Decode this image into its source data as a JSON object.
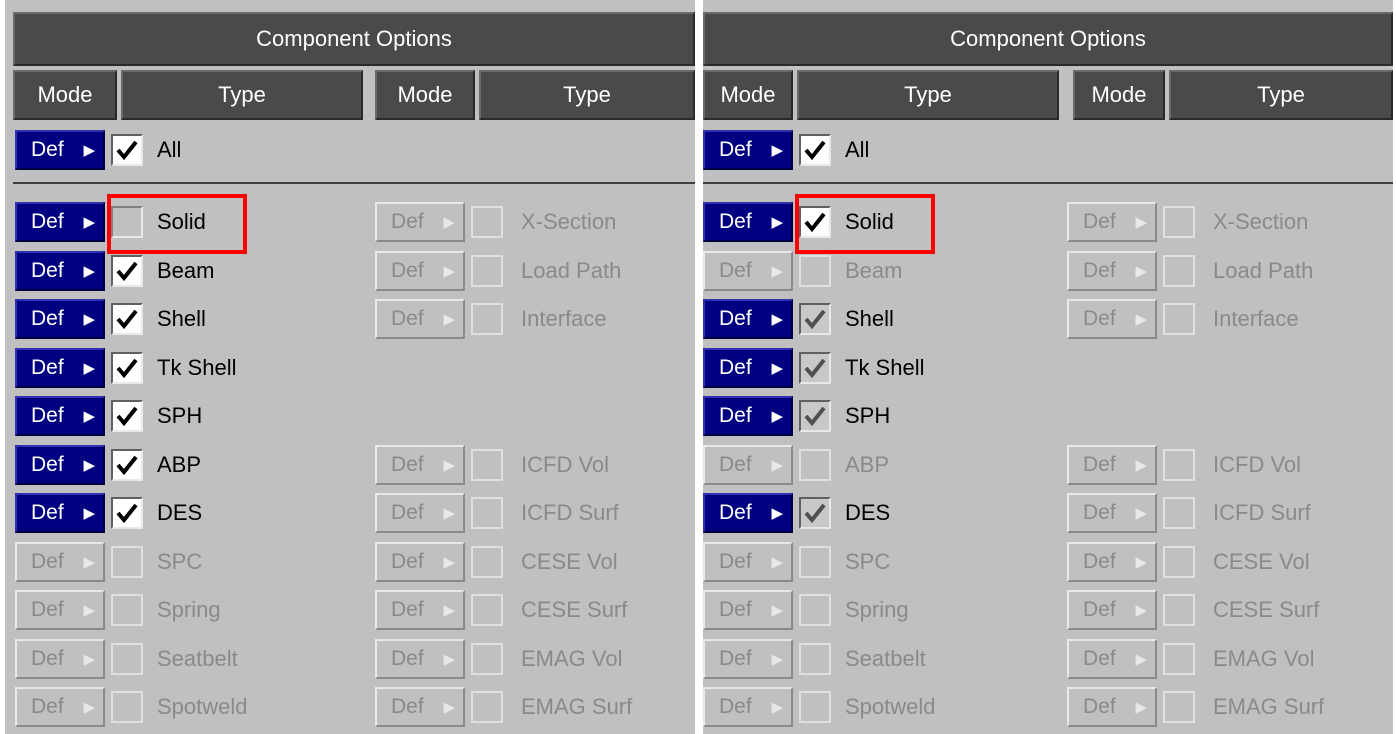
{
  "panels": [
    {
      "title": "Component Options",
      "col_mode": "Mode",
      "col_type": "Type",
      "all": {
        "mode": "Def",
        "label": "All",
        "checked": true,
        "active": true
      },
      "left_items": [
        {
          "mode": "Def",
          "label": "Solid",
          "active": true,
          "checked": false,
          "dim": false,
          "highlighted": true
        },
        {
          "mode": "Def",
          "label": "Beam",
          "active": true,
          "checked": true,
          "dim": false
        },
        {
          "mode": "Def",
          "label": "Shell",
          "active": true,
          "checked": true,
          "dim": false
        },
        {
          "mode": "Def",
          "label": "Tk Shell",
          "active": true,
          "checked": true,
          "dim": false
        },
        {
          "mode": "Def",
          "label": "SPH",
          "active": true,
          "checked": true,
          "dim": false
        },
        {
          "mode": "Def",
          "label": "ABP",
          "active": true,
          "checked": true,
          "dim": false
        },
        {
          "mode": "Def",
          "label": "DES",
          "active": true,
          "checked": true,
          "dim": false
        },
        {
          "mode": "Def",
          "label": "SPC",
          "active": false,
          "checked": false,
          "dim": false
        },
        {
          "mode": "Def",
          "label": "Spring",
          "active": false,
          "checked": false,
          "dim": false
        },
        {
          "mode": "Def",
          "label": "Seatbelt",
          "active": false,
          "checked": false,
          "dim": false
        },
        {
          "mode": "Def",
          "label": "Spotweld",
          "active": false,
          "checked": false,
          "dim": false
        }
      ],
      "right_items": [
        {
          "row": 0,
          "mode": "Def",
          "label": "X-Section",
          "active": false,
          "checked": false
        },
        {
          "row": 1,
          "mode": "Def",
          "label": "Load Path",
          "active": false,
          "checked": false
        },
        {
          "row": 2,
          "mode": "Def",
          "label": "Interface",
          "active": false,
          "checked": false
        },
        {
          "row": 5,
          "mode": "Def",
          "label": "ICFD Vol",
          "active": false,
          "checked": false
        },
        {
          "row": 6,
          "mode": "Def",
          "label": "ICFD Surf",
          "active": false,
          "checked": false
        },
        {
          "row": 7,
          "mode": "Def",
          "label": "CESE Vol",
          "active": false,
          "checked": false
        },
        {
          "row": 8,
          "mode": "Def",
          "label": "CESE Surf",
          "active": false,
          "checked": false
        },
        {
          "row": 9,
          "mode": "Def",
          "label": "EMAG Vol",
          "active": false,
          "checked": false
        },
        {
          "row": 10,
          "mode": "Def",
          "label": "EMAG Surf",
          "active": false,
          "checked": false
        }
      ]
    },
    {
      "title": "Component Options",
      "col_mode": "Mode",
      "col_type": "Type",
      "all": {
        "mode": "Def",
        "label": "All",
        "checked": true,
        "active": true
      },
      "left_items": [
        {
          "mode": "Def",
          "label": "Solid",
          "active": true,
          "checked": true,
          "dim": false,
          "highlighted": true
        },
        {
          "mode": "Def",
          "label": "Beam",
          "active": false,
          "checked": false,
          "dim": false
        },
        {
          "mode": "Def",
          "label": "Shell",
          "active": true,
          "checked": true,
          "dim": true
        },
        {
          "mode": "Def",
          "label": "Tk Shell",
          "active": true,
          "checked": true,
          "dim": true
        },
        {
          "mode": "Def",
          "label": "SPH",
          "active": true,
          "checked": true,
          "dim": true
        },
        {
          "mode": "Def",
          "label": "ABP",
          "active": false,
          "checked": false,
          "dim": false
        },
        {
          "mode": "Def",
          "label": "DES",
          "active": true,
          "checked": true,
          "dim": true
        },
        {
          "mode": "Def",
          "label": "SPC",
          "active": false,
          "checked": false,
          "dim": false
        },
        {
          "mode": "Def",
          "label": "Spring",
          "active": false,
          "checked": false,
          "dim": false
        },
        {
          "mode": "Def",
          "label": "Seatbelt",
          "active": false,
          "checked": false,
          "dim": false
        },
        {
          "mode": "Def",
          "label": "Spotweld",
          "active": false,
          "checked": false,
          "dim": false
        }
      ],
      "right_items": [
        {
          "row": 0,
          "mode": "Def",
          "label": "X-Section",
          "active": false,
          "checked": false
        },
        {
          "row": 1,
          "mode": "Def",
          "label": "Load Path",
          "active": false,
          "checked": false
        },
        {
          "row": 2,
          "mode": "Def",
          "label": "Interface",
          "active": false,
          "checked": false
        },
        {
          "row": 5,
          "mode": "Def",
          "label": "ICFD Vol",
          "active": false,
          "checked": false
        },
        {
          "row": 6,
          "mode": "Def",
          "label": "ICFD Surf",
          "active": false,
          "checked": false
        },
        {
          "row": 7,
          "mode": "Def",
          "label": "CESE Vol",
          "active": false,
          "checked": false
        },
        {
          "row": 8,
          "mode": "Def",
          "label": "CESE Surf",
          "active": false,
          "checked": false
        },
        {
          "row": 9,
          "mode": "Def",
          "label": "EMAG Vol",
          "active": false,
          "checked": false
        },
        {
          "row": 10,
          "mode": "Def",
          "label": "EMAG Surf",
          "active": false,
          "checked": false
        }
      ]
    }
  ],
  "icons": {
    "mode_arrow": "right-triangle-icon",
    "check": "checkmark-icon"
  },
  "colors": {
    "active_button": "#000080",
    "panel_bg": "#c0c0c0",
    "header_bg": "#4a4a4a",
    "highlight": "#ff0000"
  }
}
